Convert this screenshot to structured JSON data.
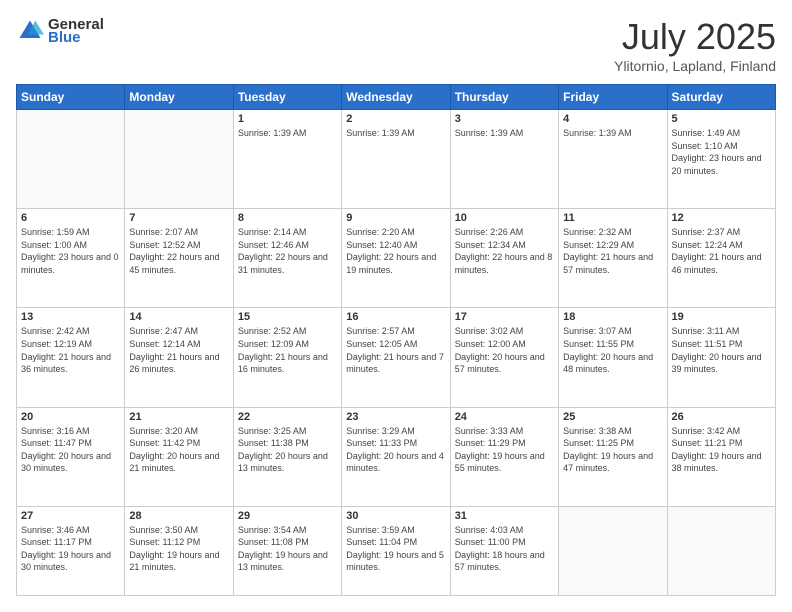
{
  "header": {
    "logo_general": "General",
    "logo_blue": "Blue",
    "month_title": "July 2025",
    "location": "Ylitornio, Lapland, Finland"
  },
  "weekdays": [
    "Sunday",
    "Monday",
    "Tuesday",
    "Wednesday",
    "Thursday",
    "Friday",
    "Saturday"
  ],
  "weeks": [
    [
      {
        "day": "",
        "info": ""
      },
      {
        "day": "",
        "info": ""
      },
      {
        "day": "1",
        "info": "Sunrise: 1:39 AM"
      },
      {
        "day": "2",
        "info": "Sunrise: 1:39 AM"
      },
      {
        "day": "3",
        "info": "Sunrise: 1:39 AM"
      },
      {
        "day": "4",
        "info": "Sunrise: 1:39 AM"
      },
      {
        "day": "5",
        "info": "Sunrise: 1:49 AM\nSunset: 1:10 AM\nDaylight: 23 hours and 20 minutes."
      }
    ],
    [
      {
        "day": "6",
        "info": "Sunrise: 1:59 AM\nSunset: 1:00 AM\nDaylight: 23 hours and 0 minutes."
      },
      {
        "day": "7",
        "info": "Sunrise: 2:07 AM\nSunset: 12:52 AM\nDaylight: 22 hours and 45 minutes."
      },
      {
        "day": "8",
        "info": "Sunrise: 2:14 AM\nSunset: 12:46 AM\nDaylight: 22 hours and 31 minutes."
      },
      {
        "day": "9",
        "info": "Sunrise: 2:20 AM\nSunset: 12:40 AM\nDaylight: 22 hours and 19 minutes."
      },
      {
        "day": "10",
        "info": "Sunrise: 2:26 AM\nSunset: 12:34 AM\nDaylight: 22 hours and 8 minutes."
      },
      {
        "day": "11",
        "info": "Sunrise: 2:32 AM\nSunset: 12:29 AM\nDaylight: 21 hours and 57 minutes."
      },
      {
        "day": "12",
        "info": "Sunrise: 2:37 AM\nSunset: 12:24 AM\nDaylight: 21 hours and 46 minutes."
      }
    ],
    [
      {
        "day": "13",
        "info": "Sunrise: 2:42 AM\nSunset: 12:19 AM\nDaylight: 21 hours and 36 minutes."
      },
      {
        "day": "14",
        "info": "Sunrise: 2:47 AM\nSunset: 12:14 AM\nDaylight: 21 hours and 26 minutes."
      },
      {
        "day": "15",
        "info": "Sunrise: 2:52 AM\nSunset: 12:09 AM\nDaylight: 21 hours and 16 minutes."
      },
      {
        "day": "16",
        "info": "Sunrise: 2:57 AM\nSunset: 12:05 AM\nDaylight: 21 hours and 7 minutes."
      },
      {
        "day": "17",
        "info": "Sunrise: 3:02 AM\nSunset: 12:00 AM\nDaylight: 20 hours and 57 minutes."
      },
      {
        "day": "18",
        "info": "Sunrise: 3:07 AM\nSunset: 11:55 PM\nDaylight: 20 hours and 48 minutes."
      },
      {
        "day": "19",
        "info": "Sunrise: 3:11 AM\nSunset: 11:51 PM\nDaylight: 20 hours and 39 minutes."
      }
    ],
    [
      {
        "day": "20",
        "info": "Sunrise: 3:16 AM\nSunset: 11:47 PM\nDaylight: 20 hours and 30 minutes."
      },
      {
        "day": "21",
        "info": "Sunrise: 3:20 AM\nSunset: 11:42 PM\nDaylight: 20 hours and 21 minutes."
      },
      {
        "day": "22",
        "info": "Sunrise: 3:25 AM\nSunset: 11:38 PM\nDaylight: 20 hours and 13 minutes."
      },
      {
        "day": "23",
        "info": "Sunrise: 3:29 AM\nSunset: 11:33 PM\nDaylight: 20 hours and 4 minutes."
      },
      {
        "day": "24",
        "info": "Sunrise: 3:33 AM\nSunset: 11:29 PM\nDaylight: 19 hours and 55 minutes."
      },
      {
        "day": "25",
        "info": "Sunrise: 3:38 AM\nSunset: 11:25 PM\nDaylight: 19 hours and 47 minutes."
      },
      {
        "day": "26",
        "info": "Sunrise: 3:42 AM\nSunset: 11:21 PM\nDaylight: 19 hours and 38 minutes."
      }
    ],
    [
      {
        "day": "27",
        "info": "Sunrise: 3:46 AM\nSunset: 11:17 PM\nDaylight: 19 hours and 30 minutes."
      },
      {
        "day": "28",
        "info": "Sunrise: 3:50 AM\nSunset: 11:12 PM\nDaylight: 19 hours and 21 minutes."
      },
      {
        "day": "29",
        "info": "Sunrise: 3:54 AM\nSunset: 11:08 PM\nDaylight: 19 hours and 13 minutes."
      },
      {
        "day": "30",
        "info": "Sunrise: 3:59 AM\nSunset: 11:04 PM\nDaylight: 19 hours and 5 minutes."
      },
      {
        "day": "31",
        "info": "Sunrise: 4:03 AM\nSunset: 11:00 PM\nDaylight: 18 hours and 57 minutes."
      },
      {
        "day": "",
        "info": ""
      },
      {
        "day": "",
        "info": ""
      }
    ]
  ]
}
